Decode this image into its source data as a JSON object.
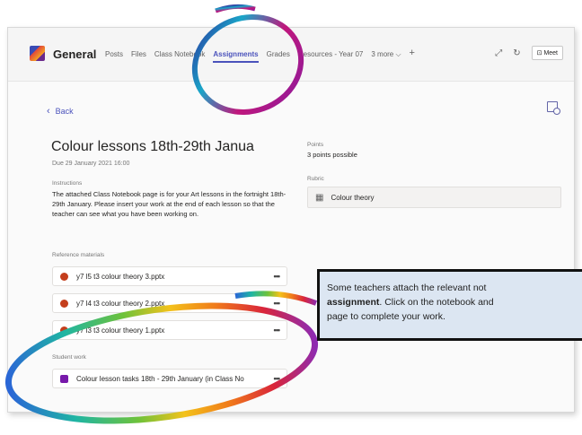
{
  "header": {
    "channel": "General",
    "tabs": [
      {
        "label": "Posts"
      },
      {
        "label": "Files"
      },
      {
        "label": "Class Notebook"
      },
      {
        "label": "Assignments"
      },
      {
        "label": "Grades"
      },
      {
        "label": "Resources - Year 07"
      },
      {
        "label": "3 more ⌵"
      }
    ],
    "add_tab": "+",
    "meet_label": "Meet"
  },
  "back_label": "Back",
  "assignment": {
    "title": "Colour lessons 18th-29th Janua",
    "due": "Due 29 January 2021 16:00",
    "instructions_label": "Instructions",
    "instructions": "The attached Class Notebook page is for your Art lessons in the fortnight 18th-29th January.  Please insert your work at the end of each lesson so that the teacher can see what you have been working on.",
    "reference_label": "Reference materials",
    "reference_files": [
      {
        "name": "y7 l5 t3 colour theory 3.pptx"
      },
      {
        "name": "y7 l4 t3 colour theory 2.pptx"
      },
      {
        "name": "y7 l3 t3 colour theory 1.pptx"
      }
    ],
    "student_work_label": "Student work",
    "student_work": {
      "name": "Colour lesson tasks 18th - 29th January (in Class No"
    },
    "more_label": "•••",
    "points_label": "Points",
    "points_value": "3 points possible",
    "rubric_label": "Rubric",
    "rubric_value": "Colour theory"
  },
  "callout": {
    "line1": "Some teachers attach the relevant not",
    "line2_bold": "assignment",
    "line2_rest": ". Click on the notebook and",
    "line3": "page to complete your work."
  },
  "colors": {
    "accent": "#4b53bc",
    "callout_bg": "#dce6f2"
  }
}
